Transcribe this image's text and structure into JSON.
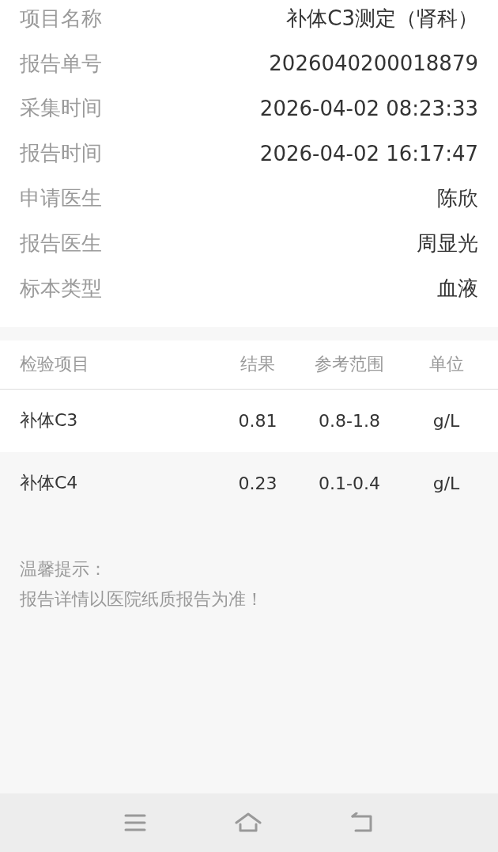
{
  "info": [
    {
      "label": "项目名称",
      "value": "补体C3测定（肾科）"
    },
    {
      "label": "报告单号",
      "value": "2026040200018879"
    },
    {
      "label": "采集时间",
      "value": "2026-04-02 08:23:33"
    },
    {
      "label": "报告时间",
      "value": "2026-04-02 16:17:47"
    },
    {
      "label": "申请医生",
      "value": "陈欣"
    },
    {
      "label": "报告医生",
      "value": "周显光"
    },
    {
      "label": "标本类型",
      "value": "血液"
    }
  ],
  "table": {
    "columns": [
      "检验项目",
      "结果",
      "参考范围",
      "单位"
    ],
    "rows": [
      [
        "补体C3",
        "0.81",
        "0.8-1.8",
        "g/L"
      ],
      [
        "补体C4",
        "0.23",
        "0.1-0.4",
        "g/L"
      ]
    ]
  },
  "notice": {
    "title": "温馨提示：",
    "text": "报告详情以医院纸质报告为准！"
  }
}
